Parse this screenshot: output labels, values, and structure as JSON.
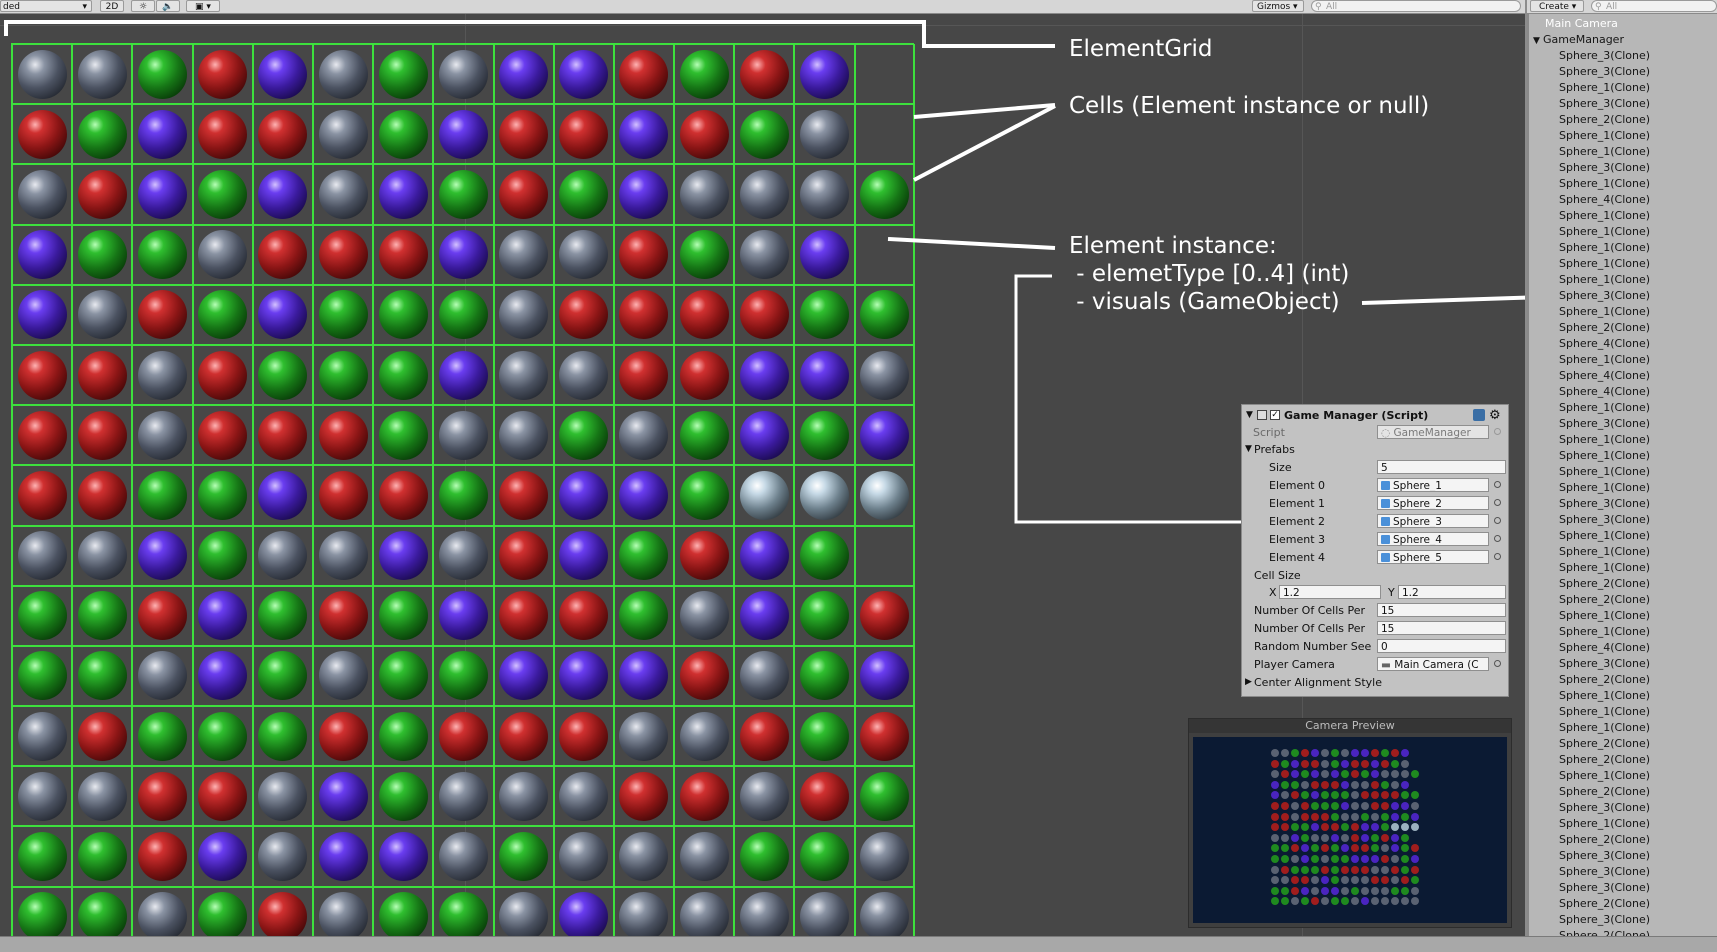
{
  "toolbar": {
    "shading_mode": "ded",
    "mode_2d": "2D",
    "gizmos_label": "Gizmos",
    "search_placeholder": "All",
    "create_label": "Create",
    "hierarchy_search_placeholder": "All"
  },
  "annotations": {
    "element_grid": "ElementGrid",
    "cells": "Cells (Element instance or null)",
    "element_instance": "Element instance:\n - elemetType [0..4] (int)\n - visuals (GameObject)"
  },
  "grid": {
    "rows": [
      [
        2,
        2,
        1,
        0,
        3,
        2,
        1,
        2,
        3,
        3,
        0,
        1,
        0,
        3,
        -1
      ],
      [
        0,
        1,
        3,
        0,
        0,
        2,
        1,
        3,
        0,
        0,
        3,
        0,
        1,
        2,
        -1
      ],
      [
        2,
        0,
        3,
        1,
        3,
        2,
        3,
        1,
        0,
        1,
        3,
        2,
        2,
        2,
        1
      ],
      [
        3,
        1,
        1,
        2,
        0,
        0,
        0,
        3,
        2,
        2,
        0,
        1,
        2,
        3,
        -1
      ],
      [
        3,
        2,
        0,
        1,
        3,
        1,
        1,
        1,
        2,
        0,
        0,
        0,
        0,
        1,
        1
      ],
      [
        0,
        0,
        2,
        0,
        1,
        1,
        1,
        3,
        2,
        2,
        0,
        0,
        3,
        3,
        2
      ],
      [
        0,
        0,
        2,
        0,
        0,
        0,
        1,
        2,
        2,
        1,
        2,
        1,
        3,
        1,
        3
      ],
      [
        0,
        0,
        1,
        1,
        3,
        0,
        0,
        1,
        0,
        3,
        3,
        1,
        4,
        4,
        4
      ],
      [
        2,
        2,
        3,
        1,
        2,
        2,
        3,
        2,
        0,
        3,
        1,
        0,
        3,
        1,
        -1
      ],
      [
        1,
        1,
        0,
        3,
        1,
        0,
        1,
        3,
        0,
        0,
        1,
        2,
        3,
        1,
        0
      ],
      [
        1,
        1,
        2,
        3,
        1,
        2,
        1,
        1,
        3,
        3,
        3,
        0,
        2,
        1,
        3
      ],
      [
        2,
        0,
        1,
        1,
        1,
        0,
        1,
        0,
        0,
        0,
        2,
        2,
        0,
        1,
        0
      ],
      [
        2,
        2,
        0,
        0,
        2,
        3,
        1,
        2,
        2,
        2,
        0,
        0,
        2,
        0,
        1
      ],
      [
        1,
        1,
        0,
        3,
        2,
        3,
        3,
        2,
        1,
        2,
        2,
        2,
        1,
        1,
        2
      ],
      [
        1,
        1,
        2,
        1,
        0,
        2,
        1,
        1,
        2,
        3,
        2,
        2,
        2,
        2,
        2
      ]
    ],
    "type_colors": [
      "#a01d1d",
      "#1f8a1f",
      "#5a6272",
      "#4a24c0",
      "#9bb0bf"
    ]
  },
  "inspector": {
    "component_title": "Game Manager (Script)",
    "script_label": "Script",
    "script_value": "GameManager",
    "prefabs_label": "Prefabs",
    "size_label": "Size",
    "size_value": "5",
    "elements": [
      {
        "label": "Element 0",
        "value": "Sphere_1"
      },
      {
        "label": "Element 1",
        "value": "Sphere_2"
      },
      {
        "label": "Element 2",
        "value": "Sphere_3"
      },
      {
        "label": "Element 3",
        "value": "Sphere_4"
      },
      {
        "label": "Element 4",
        "value": "Sphere_5"
      }
    ],
    "cell_size_label": "Cell Size",
    "cell_size_x_label": "X",
    "cell_size_x": "1.2",
    "cell_size_y_label": "Y",
    "cell_size_y": "1.2",
    "num_cells_1_label": "Number Of Cells Per",
    "num_cells_1_value": "15",
    "num_cells_2_label": "Number Of Cells Per",
    "num_cells_2_value": "15",
    "random_seed_label": "Random Number See",
    "random_seed_value": "0",
    "player_camera_label": "Player Camera",
    "player_camera_value": "Main Camera (C",
    "center_alignment_label": "Center Alignment Style"
  },
  "camera_preview": {
    "title": "Camera Preview"
  },
  "hierarchy": {
    "main_camera": "Main Camera",
    "game_manager": "GameManager",
    "children": [
      "Sphere_3(Clone)",
      "Sphere_3(Clone)",
      "Sphere_1(Clone)",
      "Sphere_3(Clone)",
      "Sphere_2(Clone)",
      "Sphere_1(Clone)",
      "Sphere_1(Clone)",
      "Sphere_3(Clone)",
      "Sphere_1(Clone)",
      "Sphere_4(Clone)",
      "Sphere_1(Clone)",
      "Sphere_1(Clone)",
      "Sphere_1(Clone)",
      "Sphere_1(Clone)",
      "Sphere_1(Clone)",
      "Sphere_3(Clone)",
      "Sphere_1(Clone)",
      "Sphere_2(Clone)",
      "Sphere_4(Clone)",
      "Sphere_1(Clone)",
      "Sphere_4(Clone)",
      "Sphere_4(Clone)",
      "Sphere_1(Clone)",
      "Sphere_3(Clone)",
      "Sphere_1(Clone)",
      "Sphere_1(Clone)",
      "Sphere_1(Clone)",
      "Sphere_1(Clone)",
      "Sphere_3(Clone)",
      "Sphere_3(Clone)",
      "Sphere_1(Clone)",
      "Sphere_1(Clone)",
      "Sphere_1(Clone)",
      "Sphere_2(Clone)",
      "Sphere_2(Clone)",
      "Sphere_1(Clone)",
      "Sphere_1(Clone)",
      "Sphere_4(Clone)",
      "Sphere_3(Clone)",
      "Sphere_2(Clone)",
      "Sphere_1(Clone)",
      "Sphere_1(Clone)",
      "Sphere_1(Clone)",
      "Sphere_2(Clone)",
      "Sphere_2(Clone)",
      "Sphere_1(Clone)",
      "Sphere_2(Clone)",
      "Sphere_3(Clone)",
      "Sphere_1(Clone)",
      "Sphere_2(Clone)",
      "Sphere_3(Clone)",
      "Sphere_3(Clone)",
      "Sphere_3(Clone)",
      "Sphere_2(Clone)",
      "Sphere_3(Clone)",
      "Sphere_2(Clone)",
      "Sphere_2(Clone)",
      "Sphere_2(Clone)",
      "Sphere_1(Clone)"
    ]
  }
}
